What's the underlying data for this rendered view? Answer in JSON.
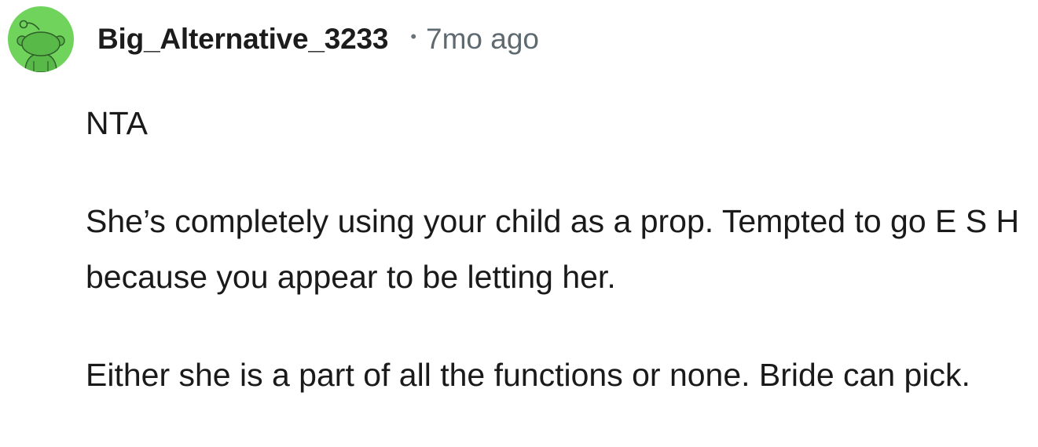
{
  "comment": {
    "author": "Big_Alternative_3233",
    "separator": "•",
    "timestamp": "7mo ago",
    "avatar_icon": "reddit-snoo-avatar-icon",
    "avatar_color": "#6fd35c",
    "paragraphs": [
      "NTA",
      "She’s completely using your child as a prop. Tempted to go E S H because you appear to be letting her.",
      "Either she is a part of all the functions or none. Bride can pick."
    ]
  }
}
